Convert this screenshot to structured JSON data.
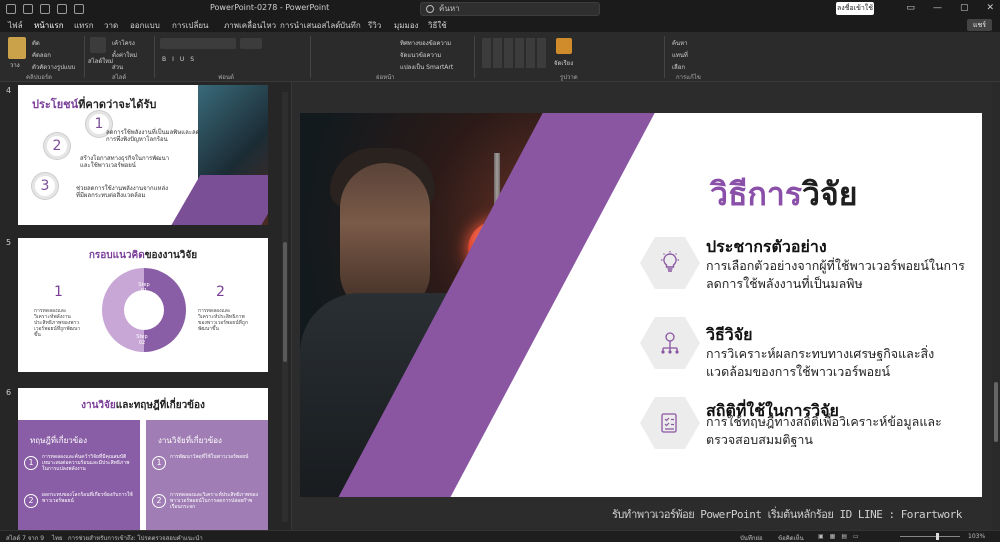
{
  "window": {
    "title": "PowerPoint-0278  -  PowerPoint",
    "search_placeholder": "ค้นหา",
    "signin": "ลงชื่อเข้าใช้",
    "share": "แชร์"
  },
  "menu": [
    "ไฟล์",
    "หน้าแรก",
    "แทรก",
    "วาด",
    "ออกแบบ",
    "การเปลี่ยน",
    "ภาพเคลื่อนไหว",
    "การนำเสนอสไลด์",
    "บันทึก",
    "รีวิว",
    "มุมมอง",
    "วิธีใช้"
  ],
  "ribbon": {
    "paste": "วาง",
    "cut": "ตัด",
    "copy": "คัดลอก",
    "format_painter": "ตัวคัดวางรูปแบบ",
    "new_slide": "สไลด์ใหม่",
    "layout": "เค้าโครง",
    "reset": "ตั้งค่าใหม่",
    "section": "ส่วน",
    "find": "ค้นหา",
    "replace": "แทนที่",
    "select": "เลือก",
    "groups": {
      "clipboard": "คลิปบอร์ด",
      "slides": "สไลด์",
      "font": "ฟอนต์",
      "paragraph": "ย่อหน้า",
      "drawing": "รูปวาด",
      "editing": "การแก้ไข"
    },
    "text_direction": "ทิศทางของข้อความ",
    "align_text": "จัดแนวข้อความ",
    "smartart": "แปลงเป็น SmartArt",
    "arrange": "จัดเรียง"
  },
  "thumbs": {
    "s4": {
      "num": "4",
      "title_a": "ประโยชน์",
      "title_b": "ที่คาดว่าจะได้รับ",
      "items": [
        {
          "n": "1",
          "text": "ลดการใช้พลังงานที่เป็นมลพิษและลดการพึ่งพิงปัญหาโลกร้อน"
        },
        {
          "n": "2",
          "text": "สร้างโอกาสทางธุรกิจในการพัฒนาและใช้พาวเวอร์พอยน์"
        },
        {
          "n": "3",
          "text": "ช่วยลดการใช้งานพลังงานจากแหล่งที่มีผลกระทบต่อสิ่งแวดล้อม"
        }
      ]
    },
    "s5": {
      "num": "5",
      "title_a": "กรอบแนวคิด",
      "title_b": "ของงานวิจัย",
      "left_num": "1",
      "left_text": "การทดลองและวิเคราะห์พลังงานประสิทธิภาพของพาวเวอร์พอยน์ที่ถูกพัฒนาขึ้น",
      "right_num": "2",
      "right_text": "การทดลองและวิเคราะห์ประสิทธิภาพของพาวเวอร์พอยน์ที่ถูกพัฒนาขึ้น",
      "step1": "Step 01",
      "step2": "Step 02"
    },
    "s6": {
      "num": "6",
      "title_a": "งานวิจัย",
      "title_b": "และทฤษฎีที่เกี่ยวข้อง",
      "col1_head": "ทฤษฎีที่เกี่ยวข้อง",
      "col1": [
        {
          "n": "1",
          "text": "การทดลองและค้นคว้าวิจัยที่มีคุณสมบัติเหมาะสมต่อความร้อนและมีประสิทธิภาพในการแปลงพลังงาน"
        },
        {
          "n": "2",
          "text": "ผลกระทบของโลกร้อนที่เกี่ยวข้องกับการใช้พาวเวอร์พอยน์"
        }
      ],
      "col2_head": "งานวิจัยที่เกี่ยวข้อง",
      "col2": [
        {
          "n": "1",
          "text": "การพัฒนาวัสดุที่ใช้ในพาวเวอร์พอยน์"
        },
        {
          "n": "2",
          "text": "การทดลองและวิเคราะห์ประสิทธิภาพของพาวเวอร์พอยน์ในการลดการปล่อยก๊าซเรือนกระจก"
        }
      ]
    }
  },
  "slide": {
    "title_a": "วิธีการ",
    "title_b": "วิจัย",
    "items": [
      {
        "icon": "lightbulb-icon",
        "head": "ประชากรตัวอย่าง",
        "body": "การเลือกตัวอย่างจากผู้ที่ใช้พาวเวอร์พอยน์ในการลดการใช้พลังงานที่เป็นมลพิษ"
      },
      {
        "icon": "brain-network-icon",
        "head": "วิธีวิจัย",
        "body": "การวิเคราะห์ผลกระทบทางเศรษฐกิจและสิ่งแวดล้อมของการใช้พาวเวอร์พอยน์"
      },
      {
        "icon": "checklist-icon",
        "head": "สถิติที่ใช้ในการวิจัย",
        "body": "การใช้ทฤษฎีทางสถิติเพื่อวิเคราะห์ข้อมูลและตรวจสอบสมมติฐาน"
      }
    ]
  },
  "caption": "รับทำพาวเวอร์พ้อย PowerPoint เริ่มต้นหลักร้อย ID LINE : Forartwork",
  "status": {
    "slide_pos": "สไลด์ 7 จาก 9",
    "lang": "ไทย",
    "accessibility": "การช่วยสำหรับการเข้าถึง: โปรดตรวจสอบคำแนะนำ",
    "notes": "บันทึกย่อ",
    "comments": "ข้อคิดเห็น",
    "zoom": "103%"
  },
  "colors": {
    "accent": "#8a4fa8",
    "ribbon": "#2b2b2b",
    "chrome": "#1b1b1b"
  }
}
